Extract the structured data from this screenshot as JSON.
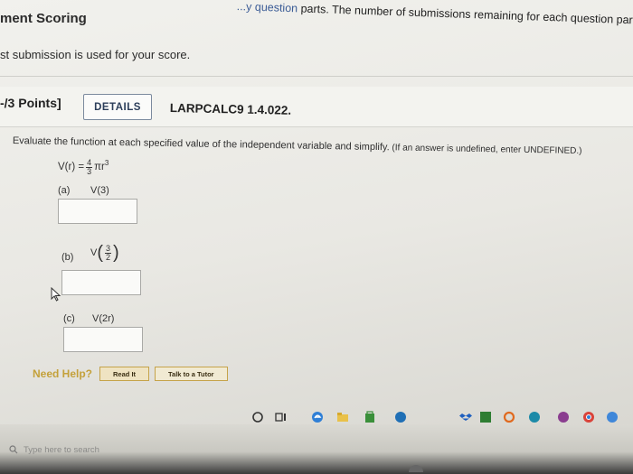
{
  "header": {
    "top_note_cut": "...y question",
    "top_note": " parts. The number of submissions remaining for each question part only chang",
    "scoring_heading": "ment Scoring",
    "scoring_text": "st submission is used for your score."
  },
  "question": {
    "points": "-/3 Points]",
    "details_label": "DETAILS",
    "question_id": "LARPCALC9 1.4.022.",
    "instruction": "Evaluate the function at each specified value of the independent variable and simplify.",
    "instruction_note": " (If an answer is undefined, enter UNDEFINED.)",
    "function": {
      "lhs": "V(r) =",
      "coef_num": "4",
      "coef_den": "3",
      "body": "πr",
      "exponent": "3"
    },
    "parts": [
      {
        "label": "(a)",
        "expr": "V(3)",
        "answer": ""
      },
      {
        "label": "(b)",
        "expr_prefix": "V",
        "frac_num": "3",
        "frac_den": "2",
        "answer": ""
      },
      {
        "label": "(c)",
        "expr": "V(2r)",
        "answer": ""
      }
    ]
  },
  "help": {
    "need_help": "Need Help?",
    "read_it": "Read It",
    "talk_to_tutor": "Talk to a Tutor"
  },
  "taskbar": {
    "search_placeholder": "Type here to search",
    "colors": {
      "edge_blue": "#2f7fd6",
      "store_green": "#3a8f3a",
      "office_orange": "#e06a1f"
    }
  }
}
